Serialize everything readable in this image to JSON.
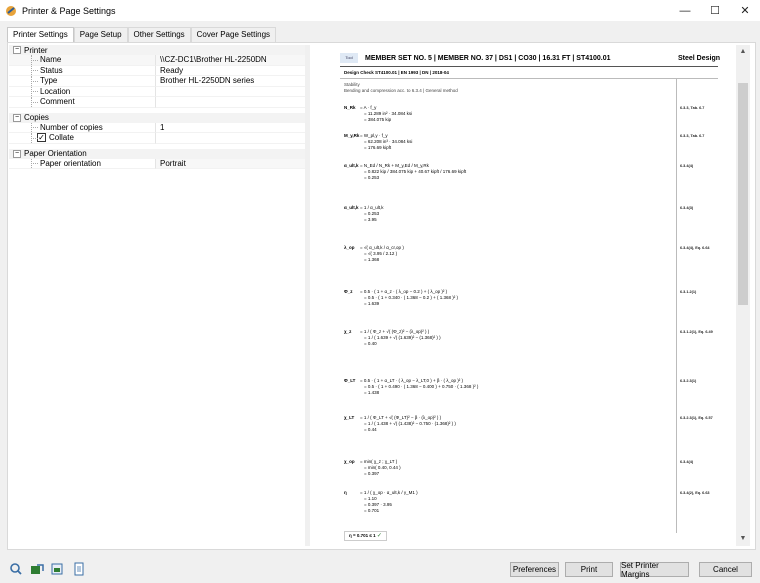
{
  "window": {
    "title": "Printer & Page Settings",
    "controls": {
      "minimize": "—",
      "maximize": "☐",
      "close": "✕"
    }
  },
  "tabs": [
    {
      "label": "Printer Settings",
      "active": true
    },
    {
      "label": "Page Setup",
      "active": false
    },
    {
      "label": "Other Settings",
      "active": false
    },
    {
      "label": "Cover Page Settings",
      "active": false
    }
  ],
  "properties": {
    "printer": {
      "group_label": "Printer",
      "rows": [
        {
          "key": "Name",
          "value": "\\\\CZ-DC1\\Brother HL-2250DN"
        },
        {
          "key": "Status",
          "value": "Ready"
        },
        {
          "key": "Type",
          "value": "Brother HL-2250DN series"
        },
        {
          "key": "Location",
          "value": ""
        },
        {
          "key": "Comment",
          "value": ""
        }
      ]
    },
    "copies": {
      "group_label": "Copies",
      "number_label": "Number of copies",
      "number_value": "1",
      "collate_label": "Collate",
      "collate_checked": true
    },
    "orientation": {
      "group_label": "Paper Orientation",
      "key": "Paper orientation",
      "value": "Portrait"
    }
  },
  "preview": {
    "logo_text": "Tool",
    "header_title": "MEMBER SET NO. 5 | MEMBER NO. 37 | DS1 | CO30 | 16.31 FT | ST4100.01",
    "header_right": "Steel Design",
    "design_check": "Design Check ST4100.01 | EN 1993 | DN | 2018-04",
    "stability": "Stability",
    "stability_sub": "Bending and compression acc. to 6.3.4 | General method",
    "formulas": [
      {
        "sym": "N_Rk",
        "lines": [
          "=  A · f_y",
          "=  11.289 in² · 34.084 ksi",
          "=  384.075 kip"
        ],
        "ref": "6.3.3, Tab. 6.7"
      },
      {
        "sym": "M_y,Rk",
        "lines": [
          "=  W_pl,y · f_y",
          "=  62.208 in³ · 34.084 ksi",
          "=  176.69 kipft"
        ],
        "ref": "6.3.3, Tab. 6.7"
      },
      {
        "sym": "α_ult,k",
        "lines": [
          "=  N_Ed / N_Rk  +  M_y,Ed / M_y,Rk",
          "=  0.822 kip / 384.075 kip  +  40.67 kipft / 176.69 kipft",
          "=  0.253"
        ],
        "ref": "6.3.4(4)"
      },
      {
        "sym": "α_ult,k",
        "lines": [
          "=  1 / α_ult,k",
          "=  0.253",
          "=  3.95"
        ],
        "ref": "6.3.4(3)"
      },
      {
        "sym": "λ_op",
        "lines": [
          "=  √( α_ult,k / α_cr,op )",
          "=  √( 3.95 / 2.12 )",
          "=  1.368"
        ],
        "ref": "6.3.4(4), Eq. 6.64"
      },
      {
        "sym": "Φ_z",
        "lines": [
          "=  0.5 · ( 1 + α_z · ( λ_op − 0.2 ) + ( λ_op )² )",
          "=  0.5 · ( 1 + 0.340 · ( 1.368 − 0.2 ) + ( 1.368 )² )",
          "=  1.639"
        ],
        "ref": "6.3.1.2(1)"
      },
      {
        "sym": "χ_z",
        "lines": [
          "=  1 / ( Φ_z + √( (Φ_z)² − (λ_op)² ) )",
          "=  1 / ( 1.639 + √( (1.639)² − (1.368)² ) )",
          "=  0.40"
        ],
        "ref": "6.3.1.2(1), Eq. 6.49"
      },
      {
        "sym": "Φ_LT",
        "lines": [
          "=  0.5 · ( 1 + α_LT · ( λ_op − λ_LT,0 ) + β · ( λ_op )² )",
          "=  0.5 · ( 1 + 0.490 · ( 1.368 − 0.400 ) + 0.750 · ( 1.368 )² )",
          "=  1.438"
        ],
        "ref": "6.3.2.3(1)"
      },
      {
        "sym": "χ_LT",
        "lines": [
          "=  1 / ( Φ_LT + √( (Φ_LT)² − β · (λ_op)² ) )",
          "=  1 / ( 1.438 + √( (1.438)² − 0.750 · (1.368)² ) )",
          "=  0.44"
        ],
        "ref": "6.3.2.3(1), Eq. 6.57"
      },
      {
        "sym": "χ_op",
        "lines": [
          "=  min( χ_z ; χ_LT )",
          "=  min( 0.40, 0.44 )",
          "=  0.397"
        ],
        "ref": "6.3.4(4)"
      },
      {
        "sym": "η",
        "lines": [
          "=  1 / ( χ_op · α_ult,k / γ_M1 )",
          "=  1.10",
          "=  0.397 · 3.95",
          "=  0.701"
        ],
        "ref": "6.3.4(2), Eq. 6.63"
      }
    ],
    "result": "η  =  0.701  ≤ 1",
    "result_mark": "✓"
  },
  "footer": {
    "icons": [
      "search-icon",
      "export-icon",
      "print-preview-icon",
      "page-icon"
    ],
    "buttons": {
      "preferences": "Preferences",
      "print": "Print",
      "set_margins": "Set Printer Margins",
      "cancel": "Cancel"
    }
  },
  "colors": {
    "accent_green": "#2e7d32",
    "icon_blue": "#3a6ea5"
  }
}
